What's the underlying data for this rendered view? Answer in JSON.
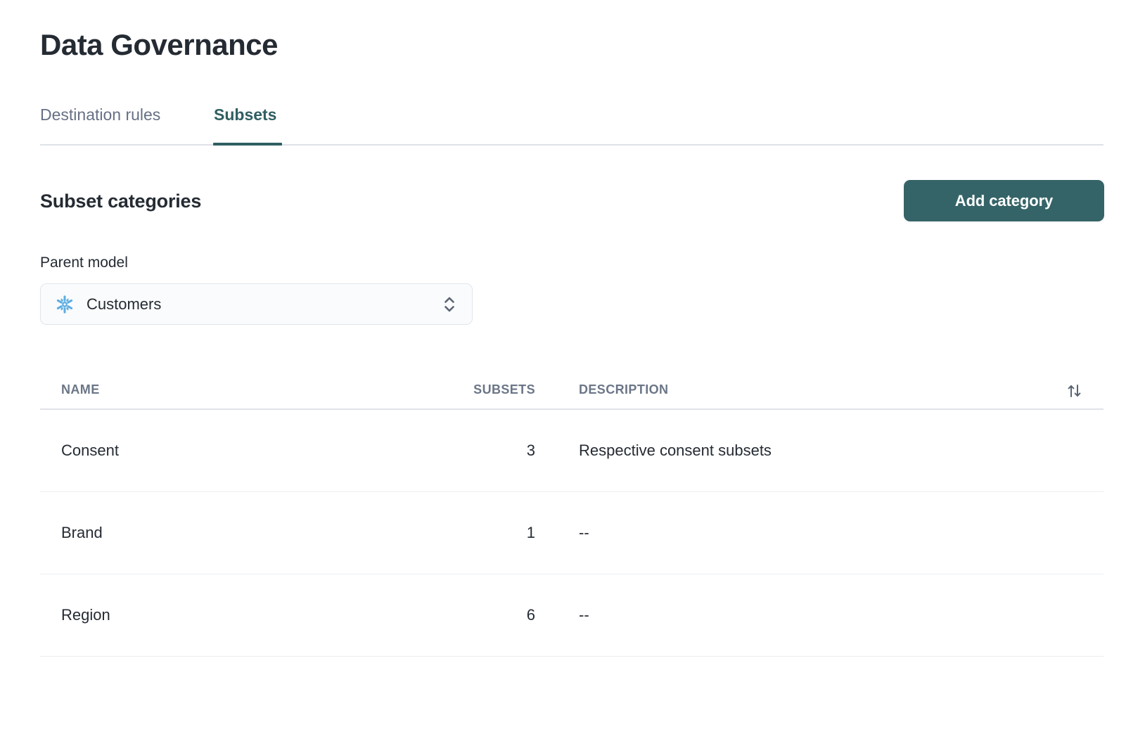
{
  "page": {
    "title": "Data Governance"
  },
  "tabs": [
    {
      "label": "Destination rules",
      "active": false
    },
    {
      "label": "Subsets",
      "active": true
    }
  ],
  "section": {
    "title": "Subset categories",
    "add_button_label": "Add category"
  },
  "parent_model": {
    "label": "Parent model",
    "selected_value": "Customers",
    "icon": "snowflake-icon",
    "stepper_icon": "chevron-up-down-icon"
  },
  "table": {
    "columns": [
      "NAME",
      "SUBSETS",
      "DESCRIPTION"
    ],
    "sort_icon": "sort-arrows-icon",
    "rows": [
      {
        "name": "Consent",
        "subsets": "3",
        "description": "Respective consent subsets"
      },
      {
        "name": "Brand",
        "subsets": "1",
        "description": "--"
      },
      {
        "name": "Region",
        "subsets": "6",
        "description": "--"
      }
    ]
  },
  "colors": {
    "accent": "#356468",
    "active_tab": "#2f5e62",
    "text": "#252b33",
    "muted_text": "#667085",
    "header_text": "#6b7687",
    "snowflake_blue": "#5dade2",
    "border": "#dfe3e8",
    "row_border": "#eceef1"
  }
}
